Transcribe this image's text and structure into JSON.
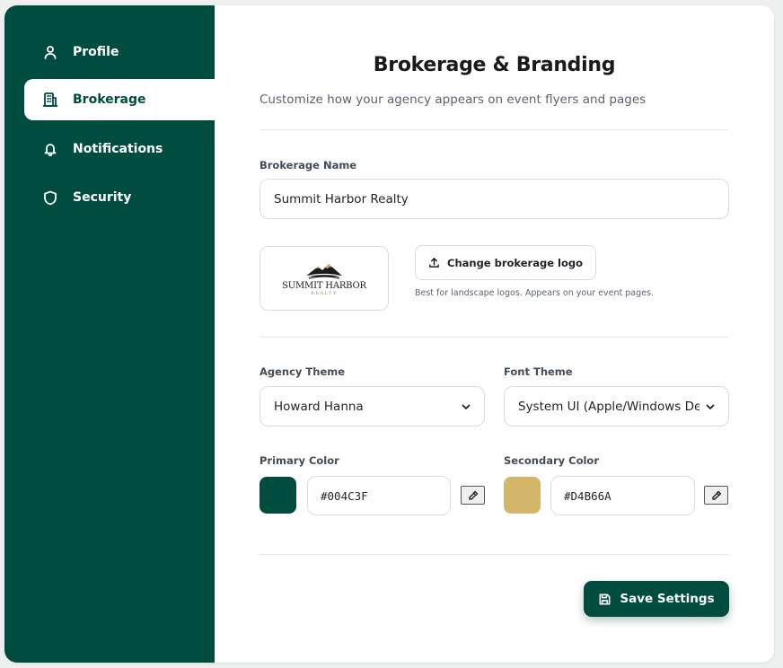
{
  "sidebar": {
    "items": [
      {
        "label": "Profile",
        "icon": "user-icon",
        "active": false
      },
      {
        "label": "Brokerage",
        "icon": "building-icon",
        "active": true
      },
      {
        "label": "Notifications",
        "icon": "bell-icon",
        "active": false
      },
      {
        "label": "Security",
        "icon": "shield-icon",
        "active": false
      }
    ]
  },
  "main": {
    "title": "Brokerage & Branding",
    "subtitle": "Customize how your agency appears on event flyers and pages",
    "brokerage_name": {
      "label": "Brokerage Name",
      "value": "Summit Harbor Realty"
    },
    "logo": {
      "name_text": "SUMMIT HARBOR",
      "sub_text": "REALTY",
      "change_button_label": "Change brokerage logo",
      "hint": "Best for landscape logos. Appears on your event pages."
    },
    "agency_theme": {
      "label": "Agency Theme",
      "value": "Howard Hanna"
    },
    "font_theme": {
      "label": "Font Theme",
      "value": "System UI (Apple/Windows Default)"
    },
    "primary_color": {
      "label": "Primary Color",
      "value": "#004C3F",
      "swatch": "#004c3f"
    },
    "secondary_color": {
      "label": "Secondary Color",
      "value": "#D4B66A",
      "swatch": "#d4b66a"
    },
    "save_button_label": "Save Settings"
  },
  "colors": {
    "brand": "#004c3f",
    "accent": "#d4b66a"
  }
}
